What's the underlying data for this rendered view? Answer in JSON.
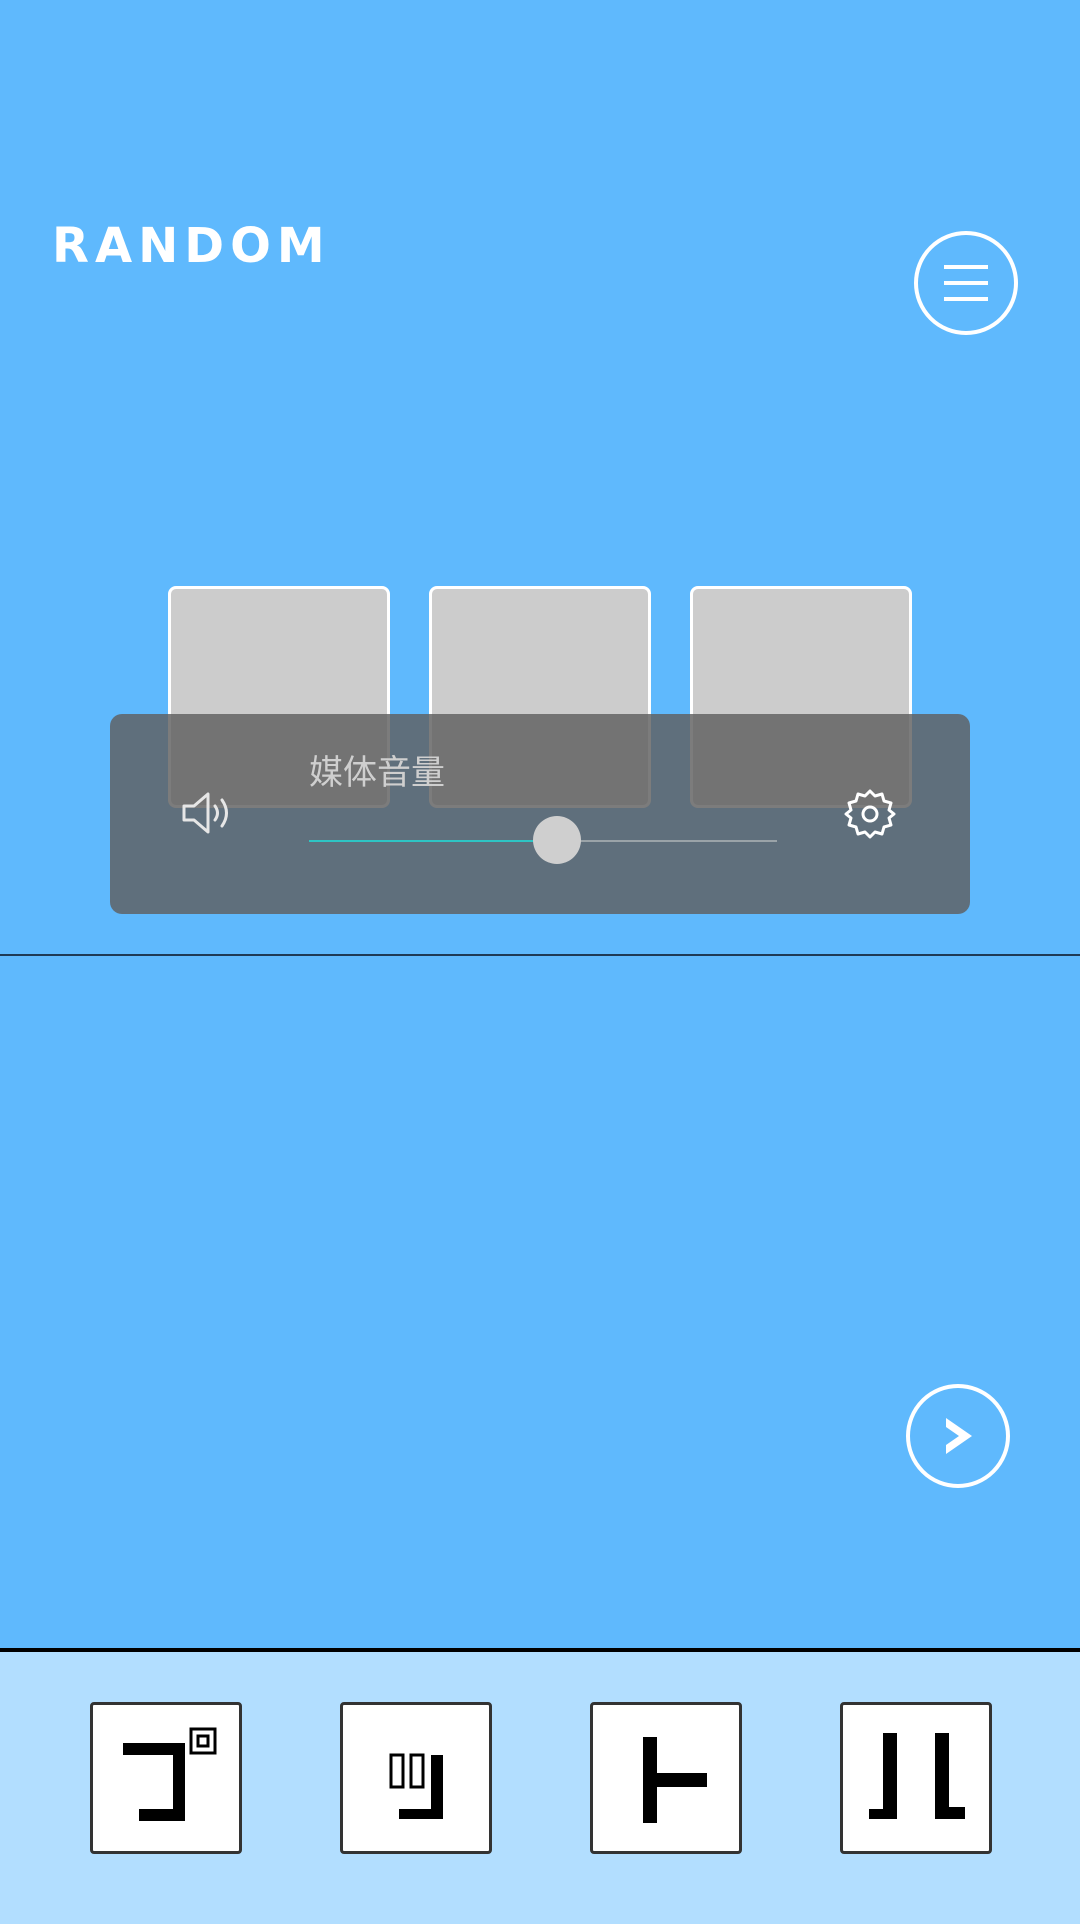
{
  "header": {
    "title": "RANDOM",
    "menu_icon": "hamburger-menu-icon"
  },
  "answer_slots": {
    "count": 3,
    "fill_color": "#cccccc"
  },
  "volume_panel": {
    "label": "媒体音量",
    "level": 0.53,
    "speaker_icon": "speaker-icon",
    "settings_icon": "gear-icon"
  },
  "navigation": {
    "next_icon": "chevron-right-icon"
  },
  "tray": {
    "tiles": [
      {
        "glyph": "katakana-go-icon"
      },
      {
        "glyph": "katakana-tsu-icon"
      },
      {
        "glyph": "katakana-to-icon"
      },
      {
        "glyph": "katakana-ru-icon"
      }
    ]
  },
  "colors": {
    "background": "#5fb9fd",
    "tray_background": "#b2deff",
    "accent": "#2ec4c4"
  }
}
